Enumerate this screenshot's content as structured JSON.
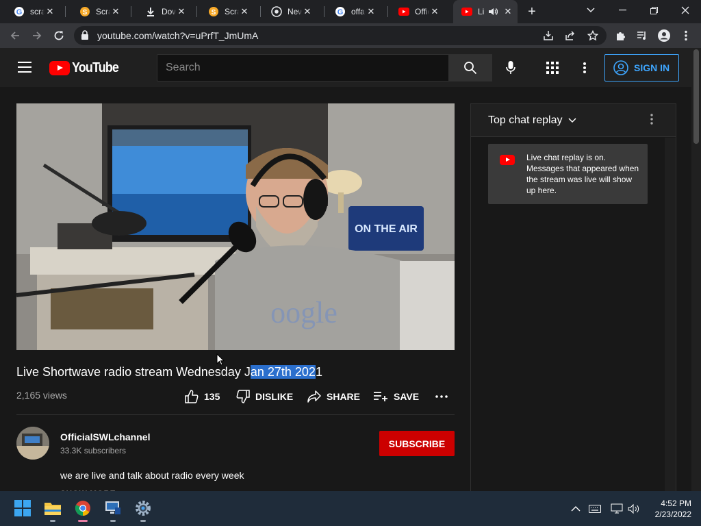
{
  "browser": {
    "tabs": [
      {
        "title": "scratch",
        "favicon": "google-icon",
        "active": false
      },
      {
        "title": "Scratch",
        "favicon": "scratch-icon",
        "active": false
      },
      {
        "title": "Downloads",
        "favicon": "download-icon",
        "active": false
      },
      {
        "title": "Scratch",
        "favicon": "scratch-icon",
        "active": false
      },
      {
        "title": "New Tab",
        "favicon": "chrome-icon",
        "active": false
      },
      {
        "title": "offacial",
        "favicon": "google-icon",
        "active": false
      },
      {
        "title": "Official",
        "favicon": "youtube-icon",
        "active": false
      },
      {
        "title": "Li",
        "favicon": "youtube-icon",
        "active": true,
        "audio": true
      }
    ],
    "url": "youtube.com/watch?v=uPrfT_JmUmA"
  },
  "youtube": {
    "logo_text": "YouTube",
    "search_placeholder": "Search",
    "sign_in_label": "SIGN IN",
    "video": {
      "title_before": "Live Shortwave radio stream Wednesday J",
      "title_selected": "an 27th 202",
      "title_after": "1",
      "views": "2,165 views",
      "likes": "135",
      "dislike_label": "DISLIKE",
      "share_label": "SHARE",
      "save_label": "SAVE",
      "player_sign_text": "ON THE AIR"
    },
    "channel": {
      "name": "OfficialSWLchannel",
      "subscribers": "33.3K subscribers",
      "subscribe_label": "SUBSCRIBE",
      "description": "we are live and talk about radio every week",
      "show_more": "SHOW MORE"
    },
    "chat": {
      "header": "Top chat replay",
      "notice": "Live chat replay is on. Messages that appeared when the stream was live will show up here."
    }
  },
  "taskbar": {
    "time": "4:52 PM",
    "date": "2/23/2022",
    "apps": [
      "windows-start-icon",
      "file-explorer-icon",
      "chrome-icon",
      "remote-desktop-icon",
      "settings-icon"
    ]
  },
  "colors": {
    "accent_red": "#ff0000",
    "subscribe_red": "#cc0000",
    "link_blue": "#3ea6ff",
    "selection_blue": "#2b6fcd"
  }
}
